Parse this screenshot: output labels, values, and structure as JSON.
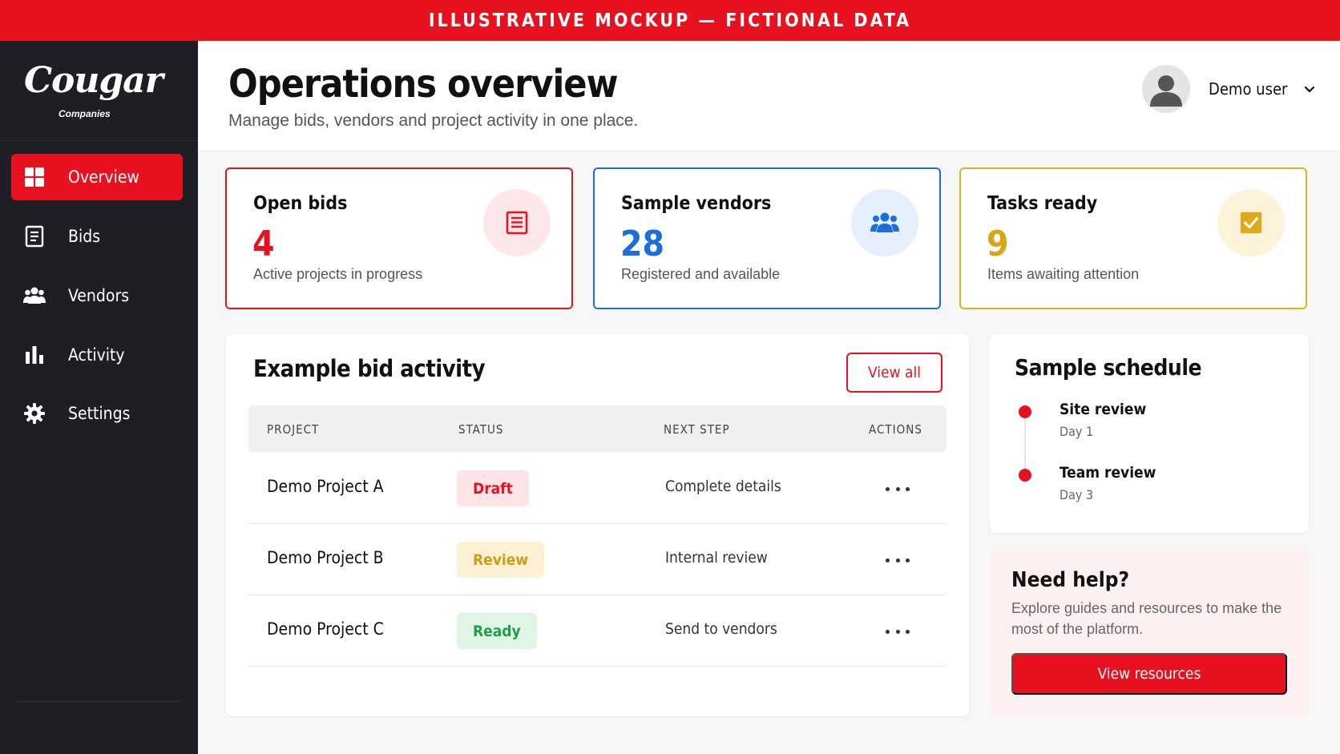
{
  "banner": {
    "text": "ILLUSTRATIVE MOCKUP — FICTIONAL DATA"
  },
  "brand": {
    "name": "Cougar",
    "sub": "Companies"
  },
  "sidebar": {
    "items": [
      {
        "label": "Overview",
        "icon": "grid-icon",
        "active": true
      },
      {
        "label": "Bids",
        "icon": "document-icon",
        "active": false
      },
      {
        "label": "Vendors",
        "icon": "people-icon",
        "active": false
      },
      {
        "label": "Activity",
        "icon": "bar-chart-icon",
        "active": false
      },
      {
        "label": "Settings",
        "icon": "gear-icon",
        "active": false
      }
    ]
  },
  "header": {
    "title": "Operations overview",
    "subtitle": "Manage bids, vendors and project activity in one place.",
    "user_name": "Demo user"
  },
  "stats": [
    {
      "title": "Open bids",
      "value": "4",
      "desc": "Active projects in progress",
      "color": "#e8111f",
      "icon": "document-icon"
    },
    {
      "title": "Sample vendors",
      "value": "28",
      "desc": "Registered and available",
      "color": "#1a6fdc",
      "icon": "people-icon"
    },
    {
      "title": "Tasks ready",
      "value": "9",
      "desc": "Items awaiting attention",
      "color": "#e0b320",
      "icon": "checkbox-icon"
    }
  ],
  "activity": {
    "title": "Example bid activity",
    "view_all": "View all",
    "columns": [
      "PROJECT",
      "STATUS",
      "NEXT STEP",
      "ACTIONS"
    ],
    "rows": [
      {
        "project": "Demo Project A",
        "status": "Draft",
        "next": "Complete details"
      },
      {
        "project": "Demo Project B",
        "status": "Review",
        "next": "Internal review"
      },
      {
        "project": "Demo Project C",
        "status": "Ready",
        "next": "Send to vendors"
      }
    ]
  },
  "schedule": {
    "title": "Sample schedule",
    "items": [
      {
        "title": "Site review",
        "day": "Day 1"
      },
      {
        "title": "Team review",
        "day": "Day 3"
      }
    ]
  },
  "help": {
    "title": "Need help?",
    "text": "Explore guides and resources to make the most of the platform.",
    "button": "View resources"
  },
  "colors": {
    "accent": "#e8111f",
    "blue": "#1a6fdc",
    "yellow": "#e0b320",
    "sidebar": "#1d1f24"
  }
}
